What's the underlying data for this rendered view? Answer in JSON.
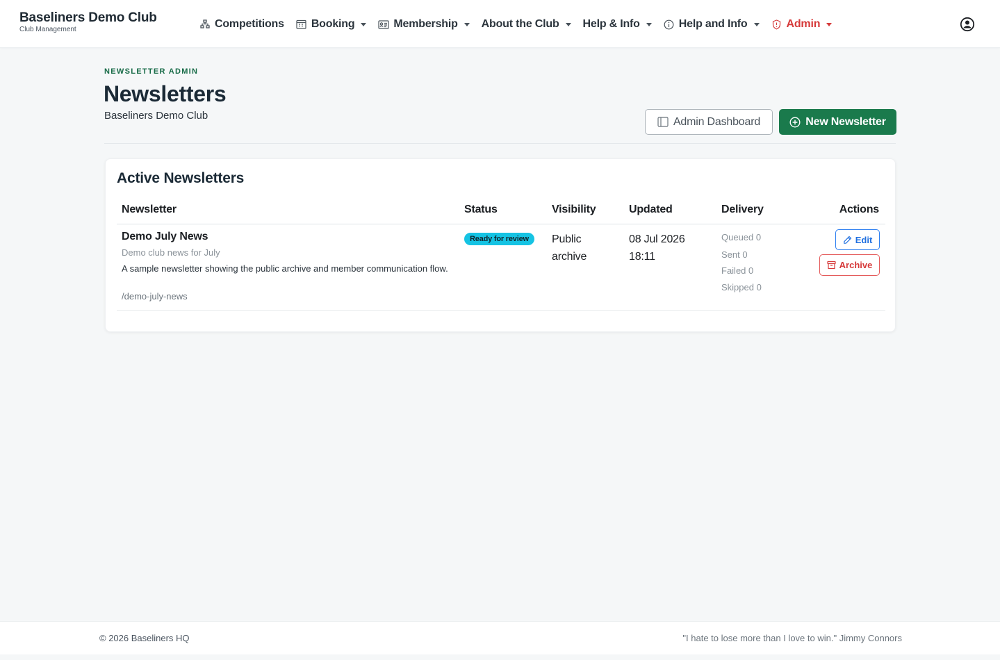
{
  "brand": {
    "name": "Baseliners Demo Club",
    "subtitle": "Club Management"
  },
  "nav": {
    "items": [
      {
        "label": "Competitions",
        "icon": "bracket-icon",
        "dropdown": false
      },
      {
        "label": "Booking",
        "icon": "calendar-icon",
        "dropdown": true
      },
      {
        "label": "Membership",
        "icon": "id-card-icon",
        "dropdown": true
      },
      {
        "label": "About the Club",
        "icon": "",
        "dropdown": true
      },
      {
        "label": "Help & Info",
        "icon": "",
        "dropdown": true
      },
      {
        "label": "Help and Info",
        "icon": "info-circle-icon",
        "dropdown": true
      },
      {
        "label": "Admin",
        "icon": "shield-icon",
        "dropdown": true,
        "color": "#d63a3a"
      }
    ],
    "user_icon": "user-circle-icon"
  },
  "header": {
    "eyebrow": "NEWSLETTER ADMIN",
    "title": "Newsletters",
    "subtitle": "Baseliners Demo Club",
    "buttons": {
      "dashboard": "Admin Dashboard",
      "new_newsletter": "New Newsletter"
    }
  },
  "table": {
    "title": "Active Newsletters",
    "columns": [
      "Newsletter",
      "Status",
      "Visibility",
      "Updated",
      "Delivery",
      "Actions"
    ],
    "rows": [
      {
        "title": "Demo July News",
        "subtitle": "Demo club news for July",
        "description": "A sample newsletter showing the public archive and member communication flow.",
        "slug": "/demo-july-news",
        "status": "Ready for review",
        "visibility": "Public archive",
        "updated_date": "08 Jul 2026",
        "updated_time": "18:11",
        "delivery": {
          "queued": "Queued 0",
          "sent": "Sent 0",
          "failed": "Failed 0",
          "skipped": "Skipped 0"
        },
        "actions": {
          "edit": "Edit",
          "archive": "Archive"
        }
      }
    ]
  },
  "footer": {
    "copyright": "© 2026 Baseliners HQ",
    "quote": "\"I hate to lose more than I love to win.\" Jimmy Connors"
  },
  "colors": {
    "primary": "#1a7a4c",
    "eyebrow": "#176b47",
    "admin": "#d63a3a",
    "badge": "#15c3e3",
    "edit": "#1f6fe0",
    "background": "#f5f7f8"
  }
}
